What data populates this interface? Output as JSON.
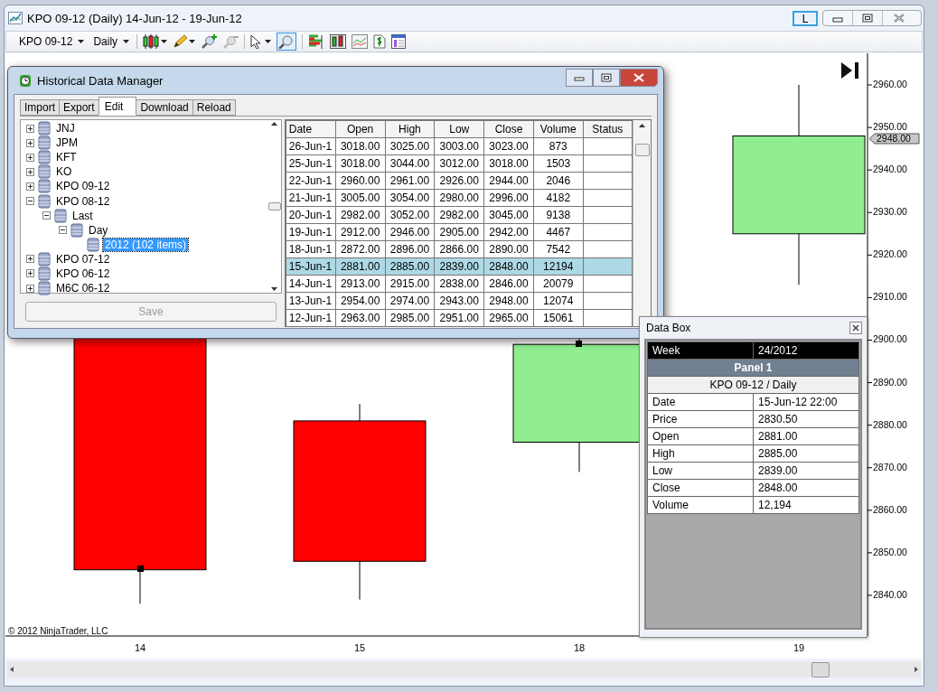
{
  "window": {
    "title": "KPO 09-12 (Daily)  14-Jun-12 - 19-Jun-12",
    "link_button": "L"
  },
  "toolbar": {
    "instrument": "KPO 09-12",
    "period": "Daily"
  },
  "chart": {
    "price_marker": "2948.00",
    "copyright": "© 2012 NinjaTrader, LLC",
    "date_labels": [
      "14",
      "15",
      "18",
      "19"
    ],
    "price_labels": [
      "2960.00",
      "2950.00",
      "2940.00",
      "2930.00",
      "2920.00",
      "2910.00",
      "2900.00",
      "2890.00",
      "2880.00",
      "2870.00",
      "2860.00",
      "2850.00",
      "2840.00"
    ]
  },
  "historical_data_manager": {
    "title": "Historical Data Manager",
    "tabs": [
      {
        "label": "Import",
        "selected": false
      },
      {
        "label": "Export",
        "selected": false
      },
      {
        "label": "Edit",
        "selected": true
      },
      {
        "label": "Download",
        "selected": false
      },
      {
        "label": "Reload",
        "selected": false
      }
    ],
    "tree": [
      {
        "label": "JNJ",
        "expanded": false,
        "selected": false
      },
      {
        "label": "JPM",
        "expanded": false,
        "selected": false
      },
      {
        "label": "KFT",
        "expanded": false,
        "selected": false
      },
      {
        "label": "KO",
        "expanded": false,
        "selected": false
      },
      {
        "label": "KPO 09-12",
        "expanded": false,
        "selected": false
      },
      {
        "label": "KPO 08-12",
        "expanded": true,
        "selected": false,
        "children": [
          {
            "label": "Last",
            "expanded": true,
            "selected": false,
            "children": [
              {
                "label": "Day",
                "expanded": true,
                "selected": false,
                "children": [
                  {
                    "label": "2012 (102 items)",
                    "selected": true
                  }
                ]
              }
            ]
          }
        ]
      },
      {
        "label": "KPO 07-12",
        "expanded": false,
        "selected": false
      },
      {
        "label": "KPO 06-12",
        "expanded": false,
        "selected": false
      },
      {
        "label": "M6C 06-12",
        "expanded": false,
        "selected": false
      }
    ],
    "save_button": {
      "label": "Save",
      "disabled": true
    },
    "table": {
      "columns": [
        "Date",
        "Open",
        "High",
        "Low",
        "Close",
        "Volume",
        "Status"
      ],
      "rows": [
        {
          "cells": [
            "26-Jun-1",
            "3018.00",
            "3025.00",
            "3003.00",
            "3023.00",
            "873"
          ],
          "selected": false
        },
        {
          "cells": [
            "25-Jun-1",
            "3018.00",
            "3044.00",
            "3012.00",
            "3018.00",
            "1503"
          ],
          "selected": false
        },
        {
          "cells": [
            "22-Jun-1",
            "2960.00",
            "2961.00",
            "2926.00",
            "2944.00",
            "2046"
          ],
          "selected": false
        },
        {
          "cells": [
            "21-Jun-1",
            "3005.00",
            "3054.00",
            "2980.00",
            "2996.00",
            "4182"
          ],
          "selected": false
        },
        {
          "cells": [
            "20-Jun-1",
            "2982.00",
            "3052.00",
            "2982.00",
            "3045.00",
            "9138"
          ],
          "selected": false
        },
        {
          "cells": [
            "19-Jun-1",
            "2912.00",
            "2946.00",
            "2905.00",
            "2942.00",
            "4467"
          ],
          "selected": false
        },
        {
          "cells": [
            "18-Jun-1",
            "2872.00",
            "2896.00",
            "2866.00",
            "2890.00",
            "7542"
          ],
          "selected": false
        },
        {
          "cells": [
            "15-Jun-1",
            "2881.00",
            "2885.00",
            "2839.00",
            "2848.00",
            "12194"
          ],
          "selected": true
        },
        {
          "cells": [
            "14-Jun-1",
            "2913.00",
            "2915.00",
            "2838.00",
            "2846.00",
            "20079"
          ],
          "selected": false
        },
        {
          "cells": [
            "13-Jun-1",
            "2954.00",
            "2974.00",
            "2943.00",
            "2948.00",
            "12074"
          ],
          "selected": false
        },
        {
          "cells": [
            "12-Jun-1",
            "2963.00",
            "2985.00",
            "2951.00",
            "2965.00",
            "15061"
          ],
          "selected": false
        }
      ]
    }
  },
  "data_box": {
    "title": "Data Box",
    "header": {
      "label": "Week",
      "value": "24/2012"
    },
    "panel": "Panel 1",
    "series": "KPO 09-12 / Daily",
    "rows": [
      {
        "label": "Date",
        "value": "15-Jun-12 22:00"
      },
      {
        "label": "Price",
        "value": "2830.50"
      },
      {
        "label": "Open",
        "value": "2881.00"
      },
      {
        "label": "High",
        "value": "2885.00"
      },
      {
        "label": "Low",
        "value": "2839.00"
      },
      {
        "label": "Close",
        "value": "2848.00"
      },
      {
        "label": "Volume",
        "value": "12,194"
      }
    ]
  }
}
